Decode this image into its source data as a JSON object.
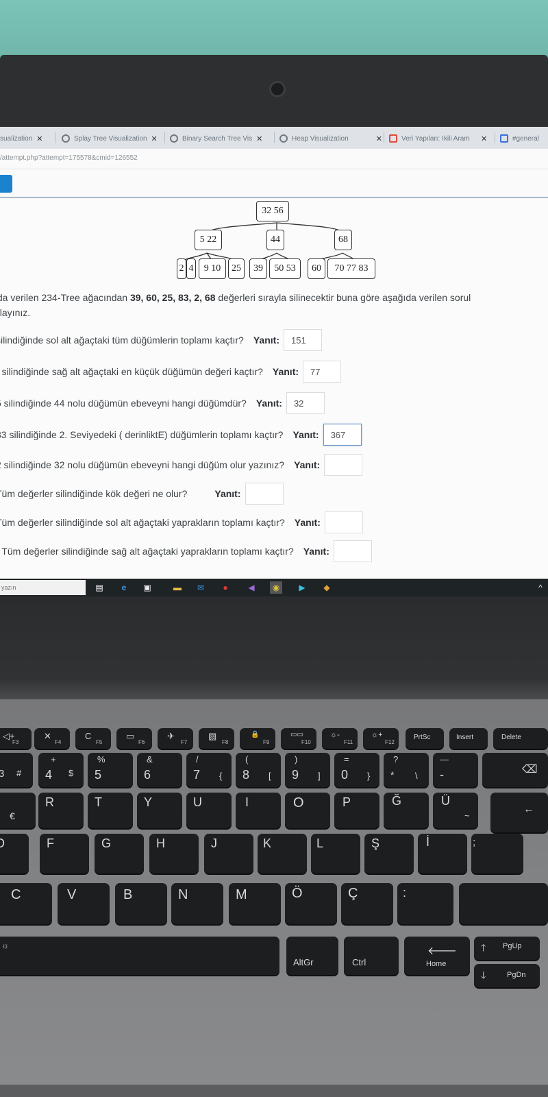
{
  "browser": {
    "tabs": [
      {
        "label": "sualization",
        "icon": "globe-icon"
      },
      {
        "label": "Splay Tree Visualization",
        "icon": "globe-icon"
      },
      {
        "label": "Binary Search Tree Vis",
        "icon": "globe-icon"
      },
      {
        "label": "Heap Visualization",
        "icon": "globe-icon"
      },
      {
        "label": "Veri Yapıları: İkili Aram",
        "icon": "moodle-icon"
      },
      {
        "label": "#general",
        "icon": "slack-icon"
      }
    ],
    "address": "/attempt.php?attempt=175578&cmid=126552"
  },
  "tree": {
    "root": "32 56",
    "level2": [
      "5 22",
      "44",
      "68"
    ],
    "leaves": [
      "2",
      "4",
      "9 10",
      "25",
      "39",
      "50 53",
      "60",
      "70 77 83"
    ]
  },
  "question": {
    "intro_a": "ıda verilen 234-Tree ağacından ",
    "intro_values": "39, 60, 25, 83, 2, 68",
    "intro_b": " değerleri sırayla silinecektir buna göre aşağıda verilen sorul",
    "intro_line2": "olayınız.",
    "yanit_label": "Yanıt:",
    "items": [
      {
        "text": "silindiğinde sol alt ağaçtaki tüm düğümlerin toplamı kaçtır?",
        "answer": "151"
      },
      {
        "text": ") silindiğinde sağ alt ağaçtaki en küçük düğümün değeri kaçtır?",
        "answer": "77"
      },
      {
        "text": "5 silindiğinde 44 nolu düğümün ebeveyni hangi düğümdür?",
        "answer": "32"
      },
      {
        "text": "33 silindiğinde 2. Seviyedeki ( derinliktE) düğümlerin toplamı kaçtır?",
        "answer": "367"
      },
      {
        "text": "2 silindiğinde 32 nolu düğümün ebeveyni hangi düğüm olur yazınız?",
        "answer": ""
      },
      {
        "text": "Tüm değerler silindiğinde kök değeri ne olur?",
        "answer": ""
      },
      {
        "text": "Tüm değerler silindiğinde sol alt ağaçtaki yaprakların toplamı kaçtır?",
        "answer": ""
      },
      {
        "text": ") Tüm değerler silindiğinde sağ alt ağaçtaki yaprakların toplamı kaçtır?",
        "answer": ""
      }
    ]
  },
  "taskbar": {
    "search_placeholder": "yazın"
  },
  "keyboard": {
    "fn_row": [
      {
        "top": "◁+",
        "fn": "F3"
      },
      {
        "top": "✕",
        "fn": "F4"
      },
      {
        "top": "C",
        "fn": "F5"
      },
      {
        "top": "▭",
        "fn": "F6"
      },
      {
        "top": "✈",
        "fn": "F7"
      },
      {
        "top": "▧",
        "fn": "F8"
      },
      {
        "top": "🔒",
        "fn": "F9"
      },
      {
        "top": "▭▭",
        "fn": "F10"
      },
      {
        "top": "☼-",
        "fn": "F11"
      },
      {
        "top": "☼+",
        "fn": "F12"
      },
      {
        "top": "PrtSc",
        "fn": ""
      },
      {
        "top": "Insert",
        "fn": ""
      },
      {
        "top": "Delete",
        "fn": ""
      }
    ],
    "num_row": [
      {
        "top": "",
        "main": "3",
        "side": "#"
      },
      {
        "top": "+",
        "main": "4",
        "side": "$"
      },
      {
        "top": "%",
        "main": "5",
        "side": ""
      },
      {
        "top": "&",
        "main": "6",
        "side": ""
      },
      {
        "top": "/",
        "main": "7",
        "side": "{"
      },
      {
        "top": "(",
        "main": "8",
        "side": "["
      },
      {
        "top": ")",
        "main": "9",
        "side": "]"
      },
      {
        "top": "=",
        "main": "0",
        "side": "}"
      },
      {
        "top": "?",
        "main": "*",
        "side": "\\"
      },
      {
        "top": "—",
        "main": "-",
        "side": ""
      }
    ],
    "row_q": [
      "€",
      "R",
      "T",
      "Y",
      "U",
      "I",
      "O",
      "P",
      "Ğ",
      "Ü"
    ],
    "row_q_extra": {
      "udiaeresis_sub": "~"
    },
    "row_a": [
      "D",
      "F",
      "G",
      "H",
      "J",
      "K",
      "L",
      "Ş",
      "İ",
      ";"
    ],
    "row_z": [
      "C",
      "V",
      "B",
      "N",
      "M",
      "Ö",
      "Ç",
      ":"
    ],
    "bottom": {
      "altgr": "AltGr",
      "ctrl": "Ctrl",
      "home": "Home",
      "pgup": "PgUp",
      "pgdn": "PgDn"
    }
  }
}
